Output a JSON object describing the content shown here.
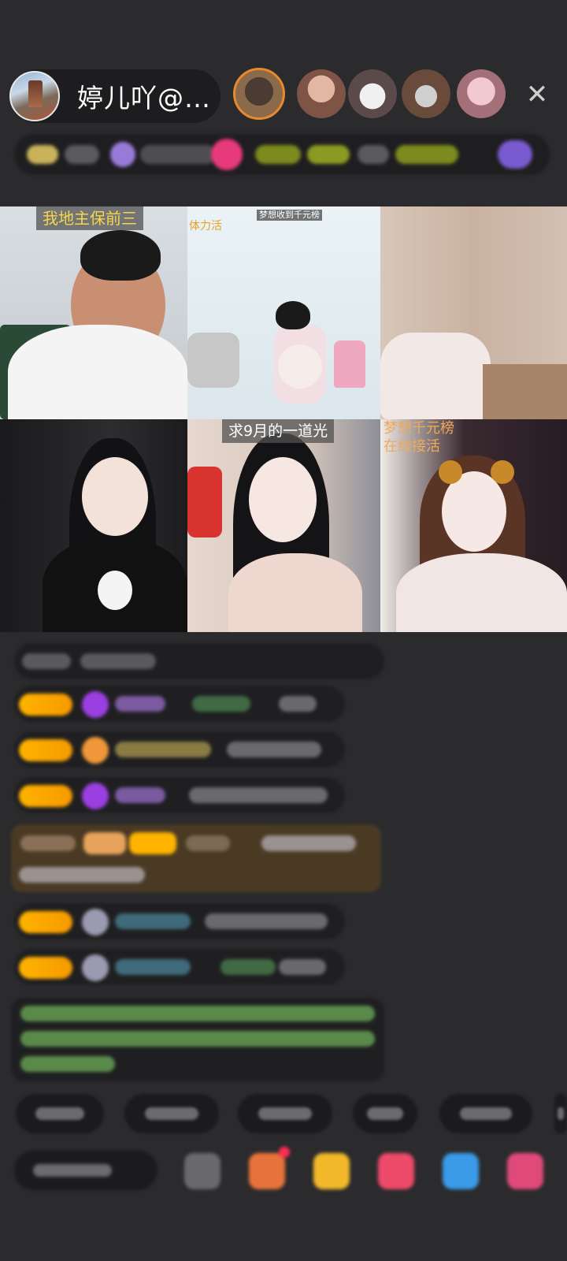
{
  "header": {
    "host_name": "婷儿吖@…",
    "close_symbol": "✕",
    "viewer_count": 5
  },
  "video_tiles": [
    {
      "label": "我地主保前三"
    },
    {
      "label_top": "梦想收到千元榜",
      "label_side": "体力活"
    },
    {
      "label": ""
    },
    {
      "label": ""
    },
    {
      "label": "求9月的一道光"
    },
    {
      "label": "梦想千元榜\n在线接活"
    }
  ],
  "colors": {
    "background": "#2b2b2d",
    "badge_gold": "#ffb300",
    "label_yellow": "#f6d64a",
    "accent_orange": "#e8892b"
  },
  "chat": {
    "message_rows": 9
  },
  "bottom_bar": {
    "shortcut_count": 5,
    "tool_icons": [
      "emoji-icon",
      "gift-box-icon",
      "gift-bag-icon",
      "red-envelope-icon",
      "game-icon",
      "more-icon"
    ]
  }
}
